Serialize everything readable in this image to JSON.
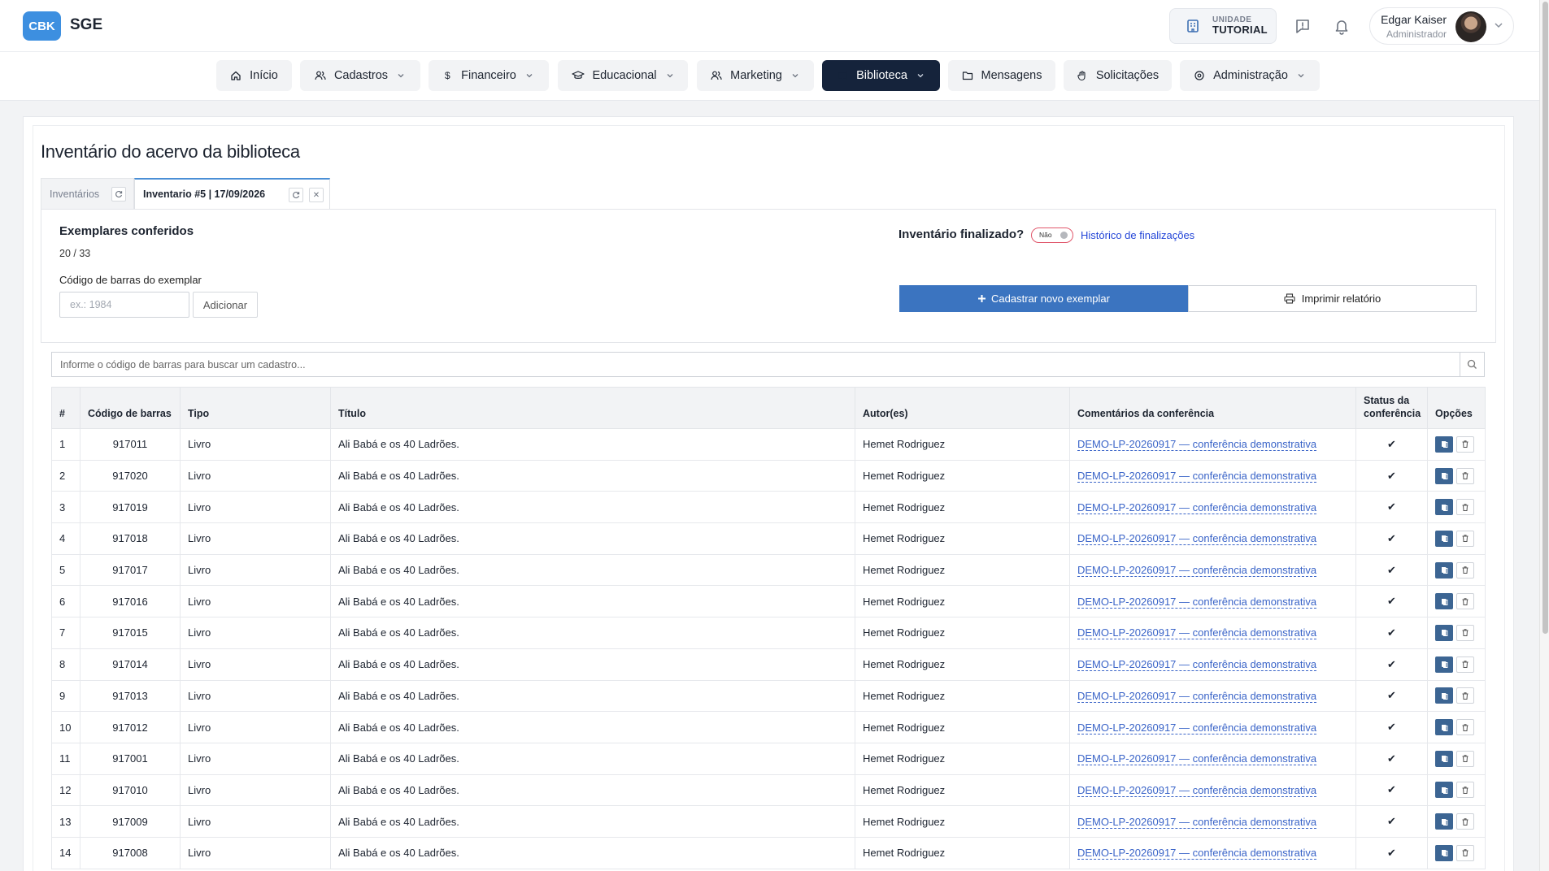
{
  "app": {
    "logo_badge": "CBK",
    "logo_text": "SGE"
  },
  "unit": {
    "label": "UNIDADE",
    "name": "TUTORIAL"
  },
  "user": {
    "name": "Edgar Kaiser",
    "role": "Administrador"
  },
  "nav": {
    "items": [
      {
        "label": "Início",
        "icon": "home-icon"
      },
      {
        "label": "Cadastros",
        "icon": "users-icon",
        "has_dropdown": true
      },
      {
        "label": "Financeiro",
        "icon": "dollar-icon",
        "has_dropdown": true
      },
      {
        "label": "Educacional",
        "icon": "graduation-cap-icon",
        "has_dropdown": true
      },
      {
        "label": "Marketing",
        "icon": "users-icon",
        "has_dropdown": true
      },
      {
        "label": "Biblioteca",
        "icon": "book-icon",
        "has_dropdown": true,
        "active": true
      },
      {
        "label": "Mensagens",
        "icon": "folder-icon"
      },
      {
        "label": "Solicitações",
        "icon": "hand-icon"
      },
      {
        "label": "Administração",
        "icon": "settings-icon",
        "has_dropdown": true
      }
    ]
  },
  "page": {
    "title": "Inventário do acervo da biblioteca",
    "tabs": [
      {
        "label": "Inventários"
      },
      {
        "label": "Inventario #5 | 17/09/2026",
        "active": true
      }
    ]
  },
  "inventory": {
    "checked_label": "Exemplares conferidos",
    "checked_count": "20 / 33",
    "barcode_label": "Código de barras do exemplar",
    "barcode_placeholder": "ex.: 1984",
    "add_button": "Adicionar",
    "finalized_label": "Inventário finalizado?",
    "finalized_toggle": "Não",
    "history_link": "Histórico de finalizações",
    "new_copy_button": "Cadastrar novo exemplar",
    "print_button": "Imprimir relatório",
    "search_placeholder": "Informe o código de barras para buscar um cadastro..."
  },
  "table": {
    "headers": {
      "num": "#",
      "code": "Código de barras",
      "type": "Tipo",
      "title": "Título",
      "authors": "Autor(es)",
      "comments": "Comentários da conferência",
      "status": "Status da conferência",
      "options": "Opções"
    },
    "rows": [
      {
        "n": "1",
        "code": "917011",
        "type": "Livro",
        "title": "Ali Babá e os 40 Ladrões.",
        "author": "Hemet Rodriguez",
        "comment": "DEMO-LP-20260917 — conferência demonstrativa",
        "status": "✔"
      },
      {
        "n": "2",
        "code": "917020",
        "type": "Livro",
        "title": "Ali Babá e os 40 Ladrões.",
        "author": "Hemet Rodriguez",
        "comment": "DEMO-LP-20260917 — conferência demonstrativa",
        "status": "✔"
      },
      {
        "n": "3",
        "code": "917019",
        "type": "Livro",
        "title": "Ali Babá e os 40 Ladrões.",
        "author": "Hemet Rodriguez",
        "comment": "DEMO-LP-20260917 — conferência demonstrativa",
        "status": "✔"
      },
      {
        "n": "4",
        "code": "917018",
        "type": "Livro",
        "title": "Ali Babá e os 40 Ladrões.",
        "author": "Hemet Rodriguez",
        "comment": "DEMO-LP-20260917 — conferência demonstrativa",
        "status": "✔"
      },
      {
        "n": "5",
        "code": "917017",
        "type": "Livro",
        "title": "Ali Babá e os 40 Ladrões.",
        "author": "Hemet Rodriguez",
        "comment": "DEMO-LP-20260917 — conferência demonstrativa",
        "status": "✔"
      },
      {
        "n": "6",
        "code": "917016",
        "type": "Livro",
        "title": "Ali Babá e os 40 Ladrões.",
        "author": "Hemet Rodriguez",
        "comment": "DEMO-LP-20260917 — conferência demonstrativa",
        "status": "✔"
      },
      {
        "n": "7",
        "code": "917015",
        "type": "Livro",
        "title": "Ali Babá e os 40 Ladrões.",
        "author": "Hemet Rodriguez",
        "comment": "DEMO-LP-20260917 — conferência demonstrativa",
        "status": "✔"
      },
      {
        "n": "8",
        "code": "917014",
        "type": "Livro",
        "title": "Ali Babá e os 40 Ladrões.",
        "author": "Hemet Rodriguez",
        "comment": "DEMO-LP-20260917 — conferência demonstrativa",
        "status": "✔"
      },
      {
        "n": "9",
        "code": "917013",
        "type": "Livro",
        "title": "Ali Babá e os 40 Ladrões.",
        "author": "Hemet Rodriguez",
        "comment": "DEMO-LP-20260917 — conferência demonstrativa",
        "status": "✔"
      },
      {
        "n": "10",
        "code": "917012",
        "type": "Livro",
        "title": "Ali Babá e os 40 Ladrões.",
        "author": "Hemet Rodriguez",
        "comment": "DEMO-LP-20260917 — conferência demonstrativa",
        "status": "✔"
      },
      {
        "n": "11",
        "code": "917001",
        "type": "Livro",
        "title": "Ali Babá e os 40 Ladrões.",
        "author": "Hemet Rodriguez",
        "comment": "DEMO-LP-20260917 — conferência demonstrativa",
        "status": "✔"
      },
      {
        "n": "12",
        "code": "917010",
        "type": "Livro",
        "title": "Ali Babá e os 40 Ladrões.",
        "author": "Hemet Rodriguez",
        "comment": "DEMO-LP-20260917 — conferência demonstrativa",
        "status": "✔"
      },
      {
        "n": "13",
        "code": "917009",
        "type": "Livro",
        "title": "Ali Babá e os 40 Ladrões.",
        "author": "Hemet Rodriguez",
        "comment": "DEMO-LP-20260917 — conferência demonstrativa",
        "status": "✔"
      },
      {
        "n": "14",
        "code": "917008",
        "type": "Livro",
        "title": "Ali Babá e os 40 Ladrões.",
        "author": "Hemet Rodriguez",
        "comment": "DEMO-LP-20260917 — conferência demonstrativa",
        "status": "✔"
      }
    ]
  },
  "colors": {
    "brand": "#3d8fe0",
    "nav_active": "#15233b",
    "primary_button": "#3b74c0",
    "link": "#2446d8",
    "toggle_border": "#e0566a"
  }
}
